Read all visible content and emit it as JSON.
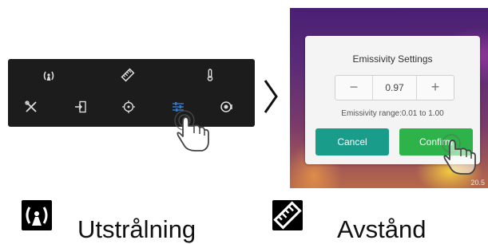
{
  "toolbar": {
    "top_row": [
      {
        "icon": "emissivity-icon"
      },
      {
        "icon": "distance-icon"
      },
      {
        "icon": "thermometer-icon"
      }
    ],
    "bottom_row": [
      {
        "icon": "tools-icon"
      },
      {
        "icon": "export-icon"
      },
      {
        "icon": "crosshair-icon"
      },
      {
        "icon": "sliders-icon",
        "active": true
      },
      {
        "icon": "palette-icon"
      }
    ],
    "active_color": "#2f78c7"
  },
  "dialog": {
    "title": "Emissivity Settings",
    "minus_label": "−",
    "plus_label": "+",
    "value": "0.97",
    "range_text": "Emissivity range:0.01 to 1.00",
    "cancel_label": "Cancel",
    "confirm_label": "Confirm",
    "cancel_color": "#1a9c8a",
    "confirm_color": "#2db34a"
  },
  "thermal": {
    "readout": "20.5"
  },
  "legend": {
    "items": [
      {
        "icon": "emissivity-icon",
        "label": "Utstrålning"
      },
      {
        "icon": "distance-icon",
        "label": "Avstånd"
      }
    ]
  }
}
